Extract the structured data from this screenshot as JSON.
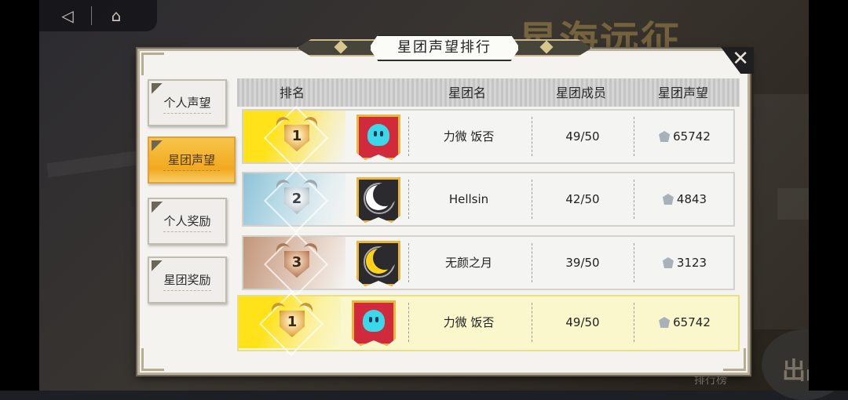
{
  "background": {
    "title": "星海远征",
    "leaderboard_label": "排行榜",
    "go_button_label": "出战"
  },
  "topbar": {
    "back_icon": "back-arrow-icon",
    "home_icon": "home-icon"
  },
  "dialog": {
    "title": "星团声望排行",
    "close_label": "✕"
  },
  "tabs": [
    {
      "label": "个人声望",
      "active": false
    },
    {
      "label": "星团声望",
      "active": true
    },
    {
      "label": "个人奖励",
      "active": false
    },
    {
      "label": "星团奖励",
      "active": false
    }
  ],
  "table": {
    "headers": {
      "rank": "排名",
      "name": "星团名",
      "members": "星团成员",
      "reputation": "星团声望"
    },
    "rows": [
      {
        "rank": "1",
        "emblem": "red-ghost",
        "name": "力微 饭否",
        "members": "49/50",
        "reputation": "65742"
      },
      {
        "rank": "2",
        "emblem": "white-moon",
        "name": "Hellsin",
        "members": "42/50",
        "reputation": "4843"
      },
      {
        "rank": "3",
        "emblem": "yellow-moon",
        "name": "无颜之月",
        "members": "39/50",
        "reputation": "3123"
      }
    ],
    "my_row": {
      "rank": "1",
      "emblem": "red-ghost",
      "name": "力微 饭否",
      "members": "49/50",
      "reputation": "65742"
    }
  },
  "colors": {
    "active_tab": "#f2a81f",
    "rank1": "#ffe21a",
    "rank2": "#8ec3d8",
    "rank3": "#c2967c",
    "my_row": "#faf7cc"
  }
}
